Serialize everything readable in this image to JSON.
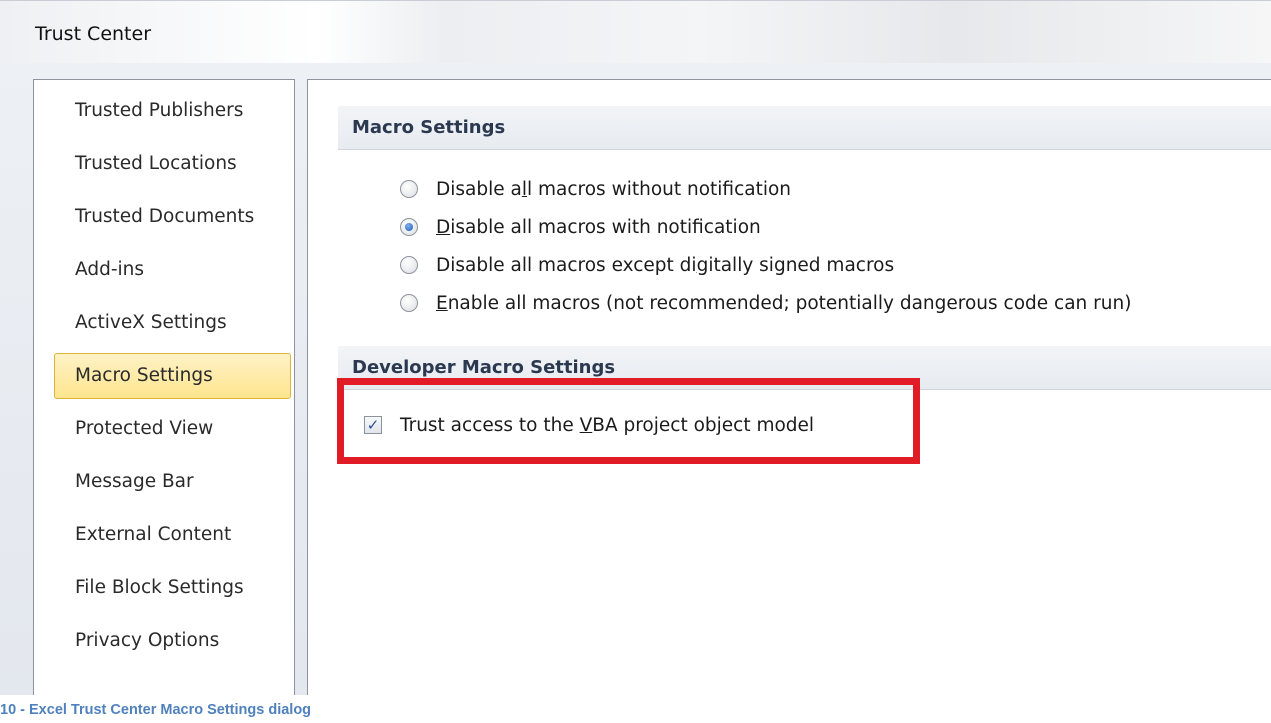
{
  "window": {
    "title": "Trust Center"
  },
  "sidebar": {
    "items": [
      {
        "label": "Trusted Publishers",
        "selected": false
      },
      {
        "label": "Trusted Locations",
        "selected": false
      },
      {
        "label": "Trusted Documents",
        "selected": false
      },
      {
        "label": "Add-ins",
        "selected": false
      },
      {
        "label": "ActiveX Settings",
        "selected": false
      },
      {
        "label": "Macro Settings",
        "selected": true
      },
      {
        "label": "Protected View",
        "selected": false
      },
      {
        "label": "Message Bar",
        "selected": false
      },
      {
        "label": "External Content",
        "selected": false
      },
      {
        "label": "File Block Settings",
        "selected": false
      },
      {
        "label": "Privacy Options",
        "selected": false
      }
    ]
  },
  "macro_settings": {
    "header": "Macro Settings",
    "options": [
      {
        "label_pre": "Disable a",
        "accel": "l",
        "label_post": "l macros without notification",
        "checked": false
      },
      {
        "label_pre": "",
        "accel": "D",
        "label_post": "isable all macros with notification",
        "checked": true
      },
      {
        "label_pre": "Disable all macros except di",
        "accel": "g",
        "label_post": "itally signed macros",
        "checked": false
      },
      {
        "label_pre": "",
        "accel": "E",
        "label_post": "nable all macros (not recommended; potentially dangerous code can run)",
        "checked": false
      }
    ]
  },
  "developer_settings": {
    "header": "Developer Macro Settings",
    "trust_vba": {
      "label_pre": "Trust access to the ",
      "accel": "V",
      "label_post": "BA project object model",
      "checked": true,
      "check_glyph": "✓"
    }
  },
  "caption": "10 - Excel Trust Center Macro Settings dialog",
  "colors": {
    "highlight": "#e11c27",
    "selected_nav": "#fde58e",
    "caption": "#4f81bd"
  }
}
